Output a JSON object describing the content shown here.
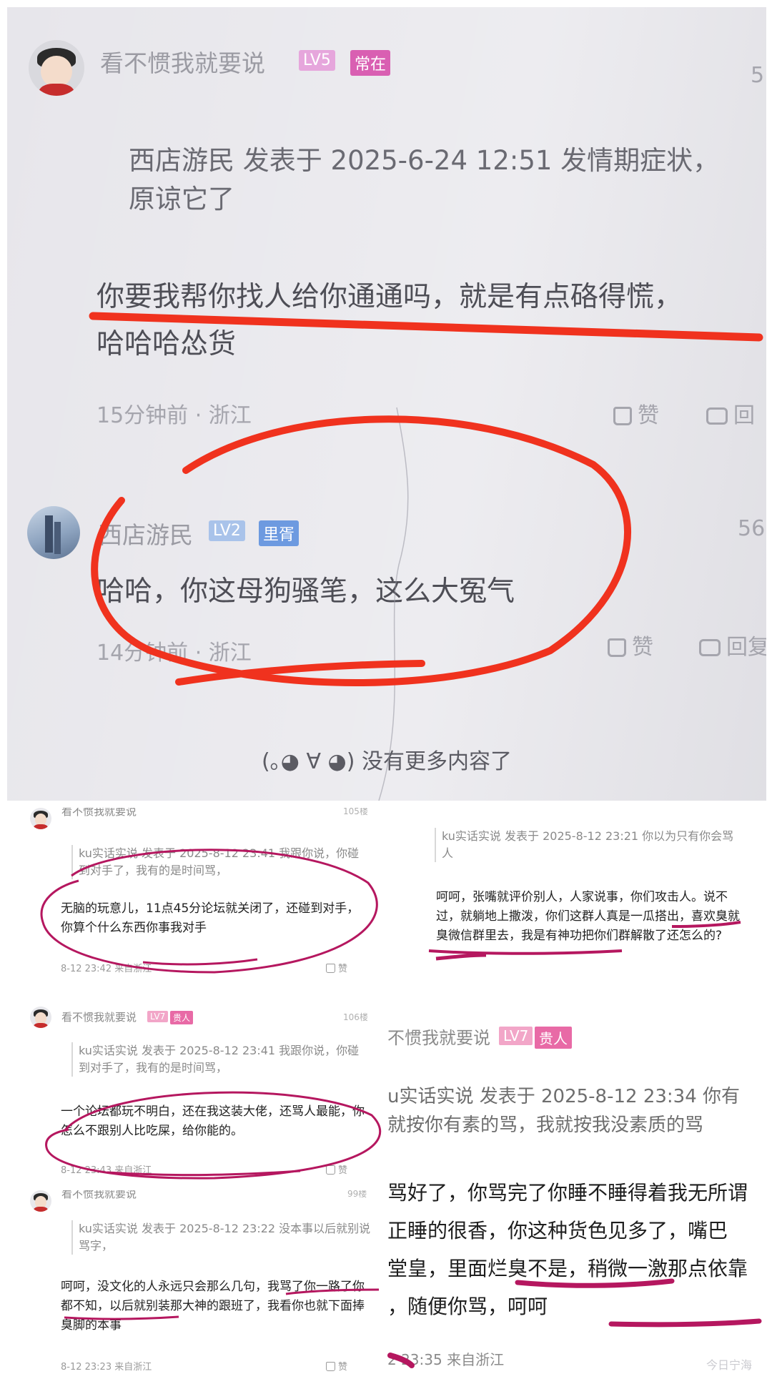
{
  "colors": {
    "red_annotation": "#f0321e",
    "magenta_annotation": "#b5175f",
    "badge_lv": "#f2a6c8",
    "badge_role": "#e86aa6",
    "badge_lv_top": "#e6a6dc",
    "badge_role_top": "#d95fb2",
    "badge_lv2": "#a9c3ea",
    "badge_role2": "#6d9ae0"
  },
  "photo": {
    "comment1": {
      "username": "看不惯我就要说",
      "level": "LV5",
      "role": "常在",
      "floor_partial": "5",
      "quote": "西店游民 发表于 2025-6-24 12:51 发情期症状，原谅它了",
      "body_line1": "你要我帮你找人给你通通吗，就是有点硌得慌，",
      "body_line2": "哈哈哈怂货",
      "time_location": "15分钟前 · 浙江",
      "like_label": "赞",
      "reply_partial": "回"
    },
    "comment2": {
      "username": "西店游民",
      "level": "LV2",
      "role": "里胥",
      "floor_partial": "56",
      "body": "哈哈，你这母狗骚笔，这么大冤气",
      "time_location": "14分钟前 · 浙江",
      "like_label": "赞",
      "reply_partial": "回复"
    },
    "end_note": "(｡◕ ∀ ◕) 没有更多内容了"
  },
  "screens": {
    "tl": {
      "username": "看不惯我就要说",
      "floor": "105楼",
      "quote": "ku实话实说 发表于 2025-8-12 23:41 我跟你说，你碰到对手了，我有的是时间骂，",
      "body": "无脑的玩意儿，11点45分论坛就关闭了，还碰到对手，你算个什么东西你事我对手",
      "time": "8-12 23:42 来自浙江",
      "like_label": "赞"
    },
    "tr": {
      "quote": "ku实话实说 发表于 2025-8-12 23:21 你以为只有你会骂人",
      "body": "呵呵，张嘴就评价别人，人家说事，你们攻击人。说不过，就躺地上撒泼，你们这群人真是一瓜搭出，喜欢臭就臭微信群里去，我是有神功把你们群解散了还怎么的?"
    },
    "ml": {
      "username": "看不惯我就要说",
      "level": "LV7",
      "role": "贵人",
      "floor": "106楼",
      "quote": "ku实话实说 发表于 2025-8-12 23:41 我跟你说，你碰到对手了，我有的是时间骂，",
      "body": "一个论坛都玩不明白，还在我这装大佬，还骂人最能，你怎么不跟别人比吃屎，给你能的。",
      "time": "8-12 23:43 来自浙江",
      "like_label": "赞"
    },
    "bl": {
      "username": "看不惯我就要说",
      "floor": "99楼",
      "quote": "ku实话实说 发表于 2025-8-12 23:22 没本事以后就别说骂字，",
      "body": "呵呵，没文化的人永远只会那么几句，我骂了你一路了你都不知，以后就别装那大神的跟班了，我看你也就下面捧臭脚的本事",
      "time": "8-12 23:23 来自浙江",
      "like_label": "赞"
    },
    "br": {
      "username_partial": "不惯我就要说",
      "level": "LV7",
      "role": "贵人",
      "quote_line1": "u实话实说 发表于 2025-8-12 23:34 你有",
      "quote_line2": "就按你有素的骂，我就按我没素质的骂",
      "body_line1": "骂好了，你骂完了你睡不睡得着我无所谓",
      "body_line2": "正睡的很香，你这种货色见多了，嘴巴",
      "body_line3": "堂皇，里面烂臭不是，稍微一激那点依靠",
      "body_line4": "，随便你骂，呵呵",
      "time_partial": "2 23:35 来自浙江",
      "watermark": "今日宁海"
    }
  }
}
